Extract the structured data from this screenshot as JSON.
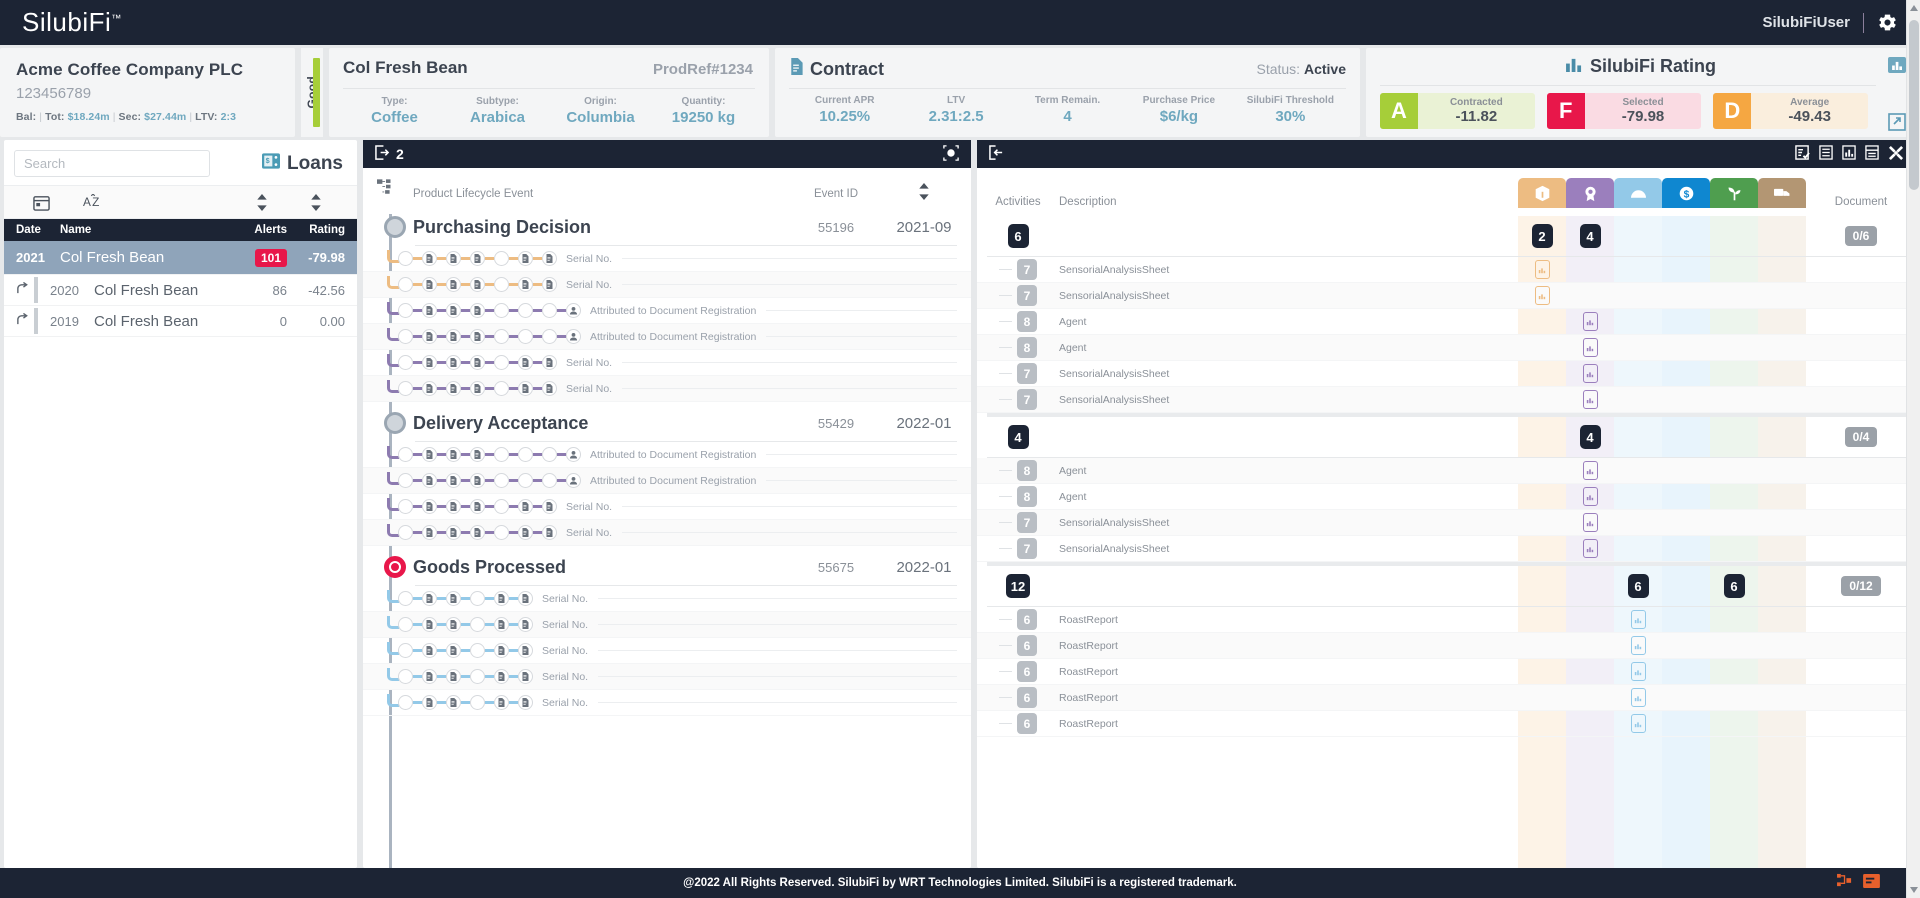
{
  "topnav": {
    "brand": "SilubiFi",
    "brand_tm": "™",
    "user": "SilubiFiUser",
    "gear_icon": "gear-icon"
  },
  "company": {
    "name": "Acme Coffee Company PLC",
    "account": "123456789",
    "bal_label": "Bal:",
    "tot_label": "Tot:",
    "tot_value": "$18.24m",
    "sec_label": "Sec:",
    "sec_value": "$27.44m",
    "ltv_label": "LTV:",
    "ltv_value": "2:3",
    "quality_label": "Good",
    "quality_color": "#a6ce39"
  },
  "product": {
    "title": "Col Fresh Bean",
    "ref": "ProdRef#1234",
    "fields": [
      {
        "key": "Type:",
        "value": "Coffee"
      },
      {
        "key": "Subtype:",
        "value": "Arabica"
      },
      {
        "key": "Origin:",
        "value": "Columbia"
      },
      {
        "key": "Quantity:",
        "value": "19250 kg"
      }
    ]
  },
  "contract": {
    "title": "Contract",
    "status_label": "Status:",
    "status_value": "Active",
    "fields": [
      {
        "key": "Current APR",
        "value": "10.25%"
      },
      {
        "key": "LTV",
        "value": "2.31:2.5"
      },
      {
        "key": "Term Remain.",
        "value": "4"
      },
      {
        "key": "Purchase Price",
        "value": "$6/kg"
      },
      {
        "key": "SilubiFi Threshold",
        "value": "30%"
      }
    ]
  },
  "rating": {
    "title": "SilubiFi Rating",
    "items": [
      {
        "grade": "A",
        "label": "Contracted",
        "value": "-11.82",
        "color": "#a6ce39",
        "bg": "#eaf2d5"
      },
      {
        "grade": "F",
        "label": "Selected",
        "value": "-79.98",
        "color": "#e8174a",
        "bg": "#fadbe3"
      },
      {
        "grade": "D",
        "label": "Average",
        "value": "-49.43",
        "color": "#f5a council",
        "bg": "#faeedd"
      }
    ]
  },
  "sidebar": {
    "search_placeholder": "Search",
    "search_value": "",
    "loans_label": "Loans",
    "sort_icons": [
      "calendar-icon",
      "alpha-sort-icon",
      "sort-updown-icon",
      "sort-updown-icon"
    ],
    "columns": [
      "Date",
      "Name",
      "Alerts",
      "Rating"
    ],
    "rows": [
      {
        "date": "2021",
        "name": "Col Fresh Bean",
        "alerts": "101",
        "rating": "-79.98",
        "selected": true
      },
      {
        "date": "2020",
        "name": "Col Fresh Bean",
        "alerts": "86",
        "rating": "-42.56",
        "selected": false
      },
      {
        "date": "2019",
        "name": "Col Fresh Bean",
        "alerts": "0",
        "rating": "0.00",
        "selected": false
      }
    ]
  },
  "timeline": {
    "header_count": "2",
    "header_icon": "export-icon",
    "header_right_icon": "target-icon",
    "columns": {
      "tree_icon": "hierarchy-icon",
      "event": "Product Lifecycle Event",
      "event_id": "Event ID",
      "sort_icon": "sort-updown-icon"
    },
    "sections": [
      {
        "title": "Purchasing Decision",
        "event_id": "55196",
        "date": "2021-09",
        "status": "normal",
        "rows": [
          {
            "label": "Serial No.",
            "color": "#edbc82",
            "nodes": [
              "circle",
              "doc",
              "doc",
              "doc",
              "circle",
              "doc",
              "doc"
            ]
          },
          {
            "label": "Serial No.",
            "color": "#edbc82",
            "nodes": [
              "circle",
              "doc",
              "doc",
              "doc",
              "circle",
              "doc",
              "doc"
            ]
          },
          {
            "label": "Attributed to Document Registration",
            "color": "#8d7bb0",
            "nodes": [
              "circle",
              "doc",
              "doc",
              "doc",
              "circle",
              "circle",
              "circle",
              "user"
            ]
          },
          {
            "label": "Attributed to Document Registration",
            "color": "#8d7bb0",
            "nodes": [
              "circle",
              "doc",
              "doc",
              "doc",
              "circle",
              "circle",
              "circle",
              "user"
            ]
          },
          {
            "label": "Serial No.",
            "color": "#8d7bb0",
            "nodes": [
              "circle",
              "doc",
              "doc",
              "doc",
              "circle",
              "doc",
              "doc"
            ]
          },
          {
            "label": "Serial No.",
            "color": "#8d7bb0",
            "nodes": [
              "circle",
              "doc",
              "doc",
              "doc",
              "circle",
              "doc",
              "doc"
            ]
          }
        ]
      },
      {
        "title": "Delivery Acceptance",
        "event_id": "55429",
        "date": "2022-01",
        "status": "normal",
        "rows": [
          {
            "label": "Attributed to Document Registration",
            "color": "#8d7bb0",
            "nodes": [
              "circle",
              "doc",
              "doc",
              "doc",
              "circle",
              "circle",
              "circle",
              "user"
            ]
          },
          {
            "label": "Attributed to Document Registration",
            "color": "#8d7bb0",
            "nodes": [
              "circle",
              "doc",
              "doc",
              "doc",
              "circle",
              "circle",
              "circle",
              "user"
            ]
          },
          {
            "label": "Serial No.",
            "color": "#8d7bb0",
            "nodes": [
              "circle",
              "doc",
              "doc",
              "doc",
              "circle",
              "doc",
              "doc"
            ]
          },
          {
            "label": "Serial No.",
            "color": "#8d7bb0",
            "nodes": [
              "circle",
              "doc",
              "doc",
              "doc",
              "circle",
              "doc",
              "doc"
            ]
          }
        ]
      },
      {
        "title": "Goods Processed",
        "event_id": "55675",
        "date": "2022-01",
        "status": "alert",
        "rows": [
          {
            "label": "Serial No.",
            "color": "#93c9e8",
            "nodes": [
              "circle",
              "doc",
              "doc",
              "circle",
              "doc",
              "doc"
            ]
          },
          {
            "label": "Serial No.",
            "color": "#93c9e8",
            "nodes": [
              "circle",
              "doc",
              "doc",
              "circle",
              "doc",
              "doc"
            ]
          },
          {
            "label": "Serial No.",
            "color": "#93c9e8",
            "nodes": [
              "circle",
              "doc",
              "doc",
              "circle",
              "doc",
              "doc"
            ]
          },
          {
            "label": "Serial No.",
            "color": "#93c9e8",
            "nodes": [
              "circle",
              "doc",
              "doc",
              "circle",
              "doc",
              "doc"
            ]
          },
          {
            "label": "Serial No.",
            "color": "#93c9e8",
            "nodes": [
              "circle",
              "doc",
              "doc",
              "circle",
              "doc",
              "doc"
            ]
          }
        ]
      }
    ]
  },
  "activities": {
    "header_icon": "collapse-left-icon",
    "header_tools": [
      "form-check-icon",
      "list-icon",
      "chart-icon",
      "report-icon",
      "tools-icon"
    ],
    "col_activities": "Activities",
    "col_description": "Description",
    "col_document": "Document",
    "categories": [
      {
        "name": "package-icon",
        "color": "#edbc82",
        "tint": "#fdf3e7"
      },
      {
        "name": "award-icon",
        "color": "#9b7fbd",
        "tint": "#f2eff7"
      },
      {
        "name": "gauge-icon",
        "color": "#93c9e8",
        "tint": "#eef7fc"
      },
      {
        "name": "dollar-icon",
        "color": "#0f87d0",
        "tint": "#e8f4fc"
      },
      {
        "name": "plant-icon",
        "color": "#4f9e4f",
        "tint": "#edf5ed"
      },
      {
        "name": "truck-icon",
        "color": "#b39673",
        "tint": "#f7f2eb"
      }
    ],
    "groups": [
      {
        "count": "6",
        "doc": "0/6",
        "cat_counts": [
          "2",
          "4",
          "",
          "",
          "",
          ""
        ],
        "rows": [
          {
            "count": "7",
            "description": "SensorialAnalysisSheet",
            "cat": 0
          },
          {
            "count": "7",
            "description": "SensorialAnalysisSheet",
            "cat": 0
          },
          {
            "count": "8",
            "description": "Agent",
            "cat": 1
          },
          {
            "count": "8",
            "description": "Agent",
            "cat": 1
          },
          {
            "count": "7",
            "description": "SensorialAnalysisSheet",
            "cat": 1
          },
          {
            "count": "7",
            "description": "SensorialAnalysisSheet",
            "cat": 1
          }
        ]
      },
      {
        "count": "4",
        "doc": "0/4",
        "cat_counts": [
          "",
          "4",
          "",
          "",
          "",
          ""
        ],
        "rows": [
          {
            "count": "8",
            "description": "Agent",
            "cat": 1
          },
          {
            "count": "8",
            "description": "Agent",
            "cat": 1
          },
          {
            "count": "7",
            "description": "SensorialAnalysisSheet",
            "cat": 1
          },
          {
            "count": "7",
            "description": "SensorialAnalysisSheet",
            "cat": 1
          }
        ]
      },
      {
        "count": "12",
        "doc": "0/12",
        "cat_counts": [
          "",
          "",
          "6",
          "",
          "6",
          ""
        ],
        "rows": [
          {
            "count": "6",
            "description": "RoastReport",
            "cat": 2
          },
          {
            "count": "6",
            "description": "RoastReport",
            "cat": 2
          },
          {
            "count": "6",
            "description": "RoastReport",
            "cat": 2
          },
          {
            "count": "6",
            "description": "RoastReport",
            "cat": 2
          },
          {
            "count": "6",
            "description": "RoastReport",
            "cat": 2
          }
        ]
      }
    ]
  },
  "footer": {
    "text": "@2022 All Rights Reserved. SilubiFi by WRT Technologies Limited. SilubiFi is a registered trademark.",
    "icons": [
      "flow-icon",
      "window-icon"
    ]
  }
}
